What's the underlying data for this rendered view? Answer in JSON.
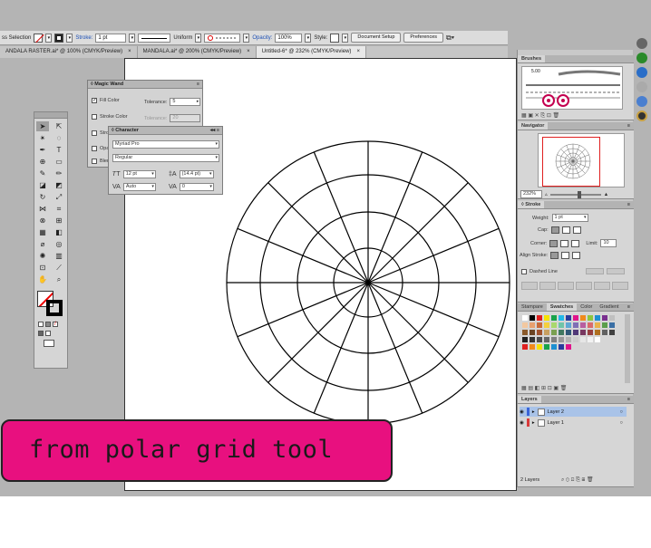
{
  "control_bar": {
    "selection_label": "ss Selection",
    "stroke_label": "Stroke:",
    "stroke_weight": "1 pt",
    "stroke_profile": "Uniform",
    "opacity_label": "Opacity:",
    "opacity_value": "100%",
    "style_label": "Style:",
    "document_setup": "Document Setup",
    "preferences": "Preferences"
  },
  "doc_tabs": [
    {
      "label": "ANDALA RASTER.ai* @ 100% (CMYK/Preview)",
      "active": false
    },
    {
      "label": "MANDALA.ai* @ 200% (CMYK/Preview)",
      "active": false
    },
    {
      "label": "Untitled-6* @ 232% (CMYK/Preview)",
      "active": true
    }
  ],
  "tab_close": "×",
  "magic_wand": {
    "title": "◊ Magic Wand",
    "fill_color": "Fill Color",
    "tolerance_label": "Tolerance:",
    "tolerance_value": "5",
    "stroke_color": "Stroke Color",
    "stroke_tolerance_label": "Tolerance:",
    "stroke_tolerance_value": "20",
    "row3": "Stro",
    "row4": "Opa",
    "row5": "Blen"
  },
  "character": {
    "title": "◊ Character",
    "font_family": "Myriad Pro",
    "font_style": "Regular",
    "font_size": "12 pt",
    "leading": "(14.4 pt)",
    "kerning": "Auto",
    "tracking": "0"
  },
  "brushes": {
    "title": "Brushes",
    "brush_size": "5.00"
  },
  "navigator": {
    "title": "Navigator",
    "zoom": "232%"
  },
  "stroke_panel": {
    "title": "◊ Stroke",
    "weight_label": "Weight:",
    "weight_value": "1 pt",
    "cap_label": "Cap:",
    "corner_label": "Corner:",
    "limit_label": "Limit:",
    "limit_value": "10",
    "align_label": "Align Stroke:",
    "dashed_label": "Dashed Line"
  },
  "swatches_tabs": [
    "Stampare",
    "Swatches",
    "Color",
    "Gradient"
  ],
  "swatch_colors": [
    "#ffffff",
    "#000000",
    "#e02020",
    "#f5e100",
    "#19a34a",
    "#23b8e8",
    "#2a3b9c",
    "#e0138b",
    "#f08a1c",
    "#8cc63f",
    "#1d8fd1",
    "#7a2f8f",
    "#c0c0c0",
    "#f2c8a0",
    "#e8a070",
    "#c86a3a",
    "#f4d03f",
    "#a9d86e",
    "#6fc4a8",
    "#5fa8d3",
    "#7f6fb5",
    "#b85fa0",
    "#d96b6b",
    "#e9b24a",
    "#5a9e4b",
    "#3a6fa5",
    "#8a5a2b",
    "#6b4423",
    "#a0522d",
    "#c8a060",
    "#7aa050",
    "#407860",
    "#305878",
    "#503878",
    "#783860",
    "#984040",
    "#b07020",
    "#606060",
    "#404040",
    "#202020",
    "#333333",
    "#4d4d4d",
    "#666666",
    "#808080",
    "#999999",
    "#b3b3b3",
    "#cccccc",
    "#e6e6e6",
    "#f2f2f2",
    "#ffffff",
    "#d6d6d6",
    "#d6d6d6",
    "#e02020",
    "#f08a1c",
    "#f5e100",
    "#19a34a",
    "#1d8fd1",
    "#2a3b9c",
    "#e0138b",
    "#d6d6d6",
    "#d6d6d6",
    "#d6d6d6",
    "#d6d6d6",
    "#d6d6d6",
    "#d6d6d6"
  ],
  "layers": {
    "title": "Layers",
    "items": [
      "Layer 2",
      "Layer 1"
    ],
    "footer": "2 Layers"
  },
  "caption": "from polar grid tool"
}
